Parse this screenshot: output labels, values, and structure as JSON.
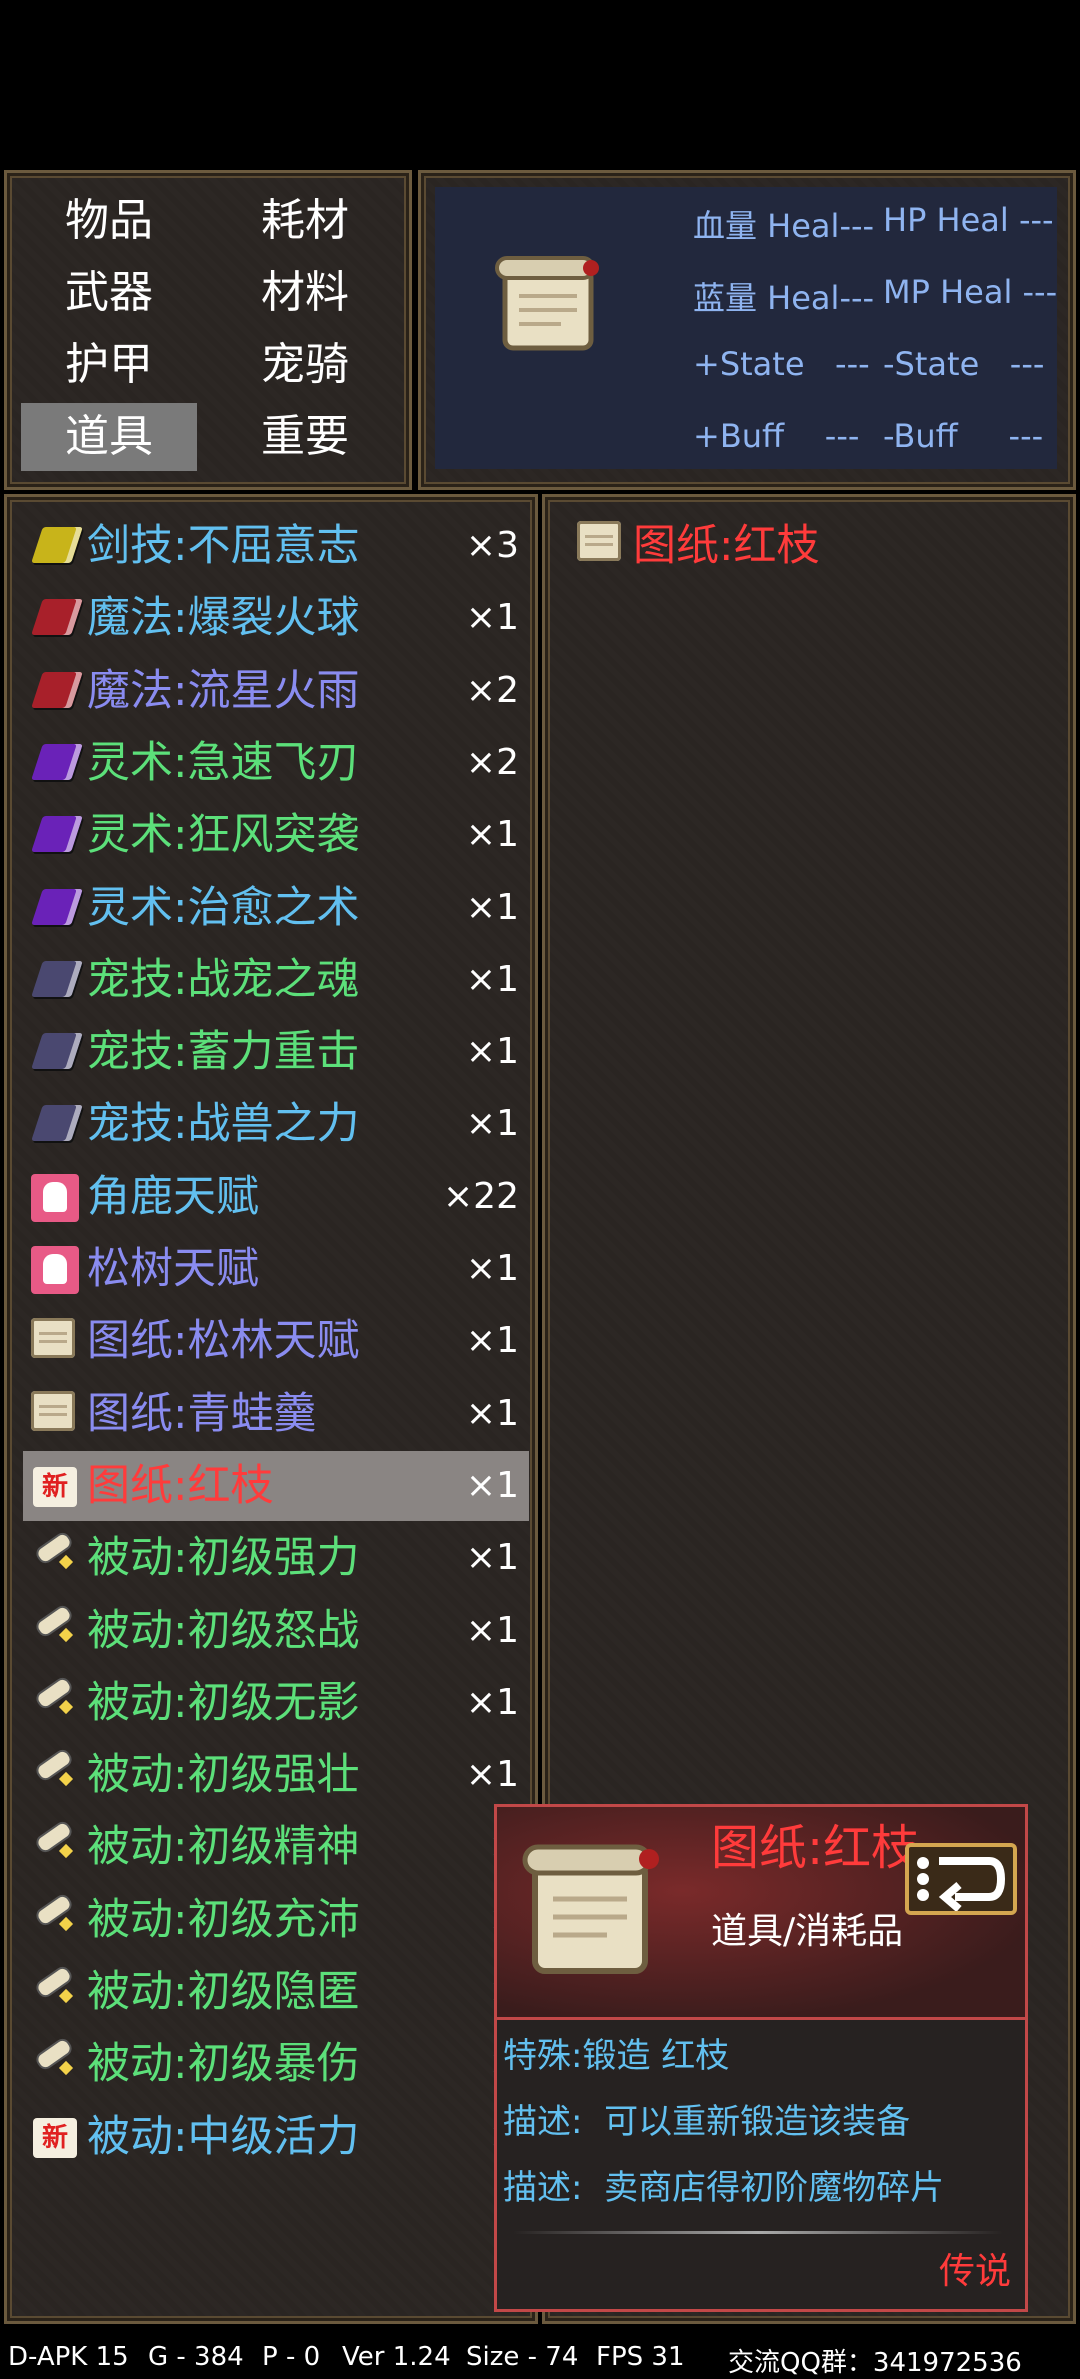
{
  "categories": [
    "物品",
    "耗材",
    "武器",
    "材料",
    "护甲",
    "宠骑",
    "道具",
    "重要"
  ],
  "selected_category": "道具",
  "stats": {
    "hp_heal_label": "血量 Heal",
    "hp_heal_value": "---",
    "hp_heal_en_label": "HP Heal",
    "hp_heal_en_value": "---",
    "mp_heal_label": "蓝量 Heal",
    "mp_heal_value": "---",
    "mp_heal_en_label": "MP Heal",
    "mp_heal_en_value": "---",
    "plus_state_label": "+State",
    "plus_state_value": "---",
    "minus_state_label": "-State",
    "minus_state_value": "---",
    "plus_buff_label": "+Buff",
    "plus_buff_value": "---",
    "minus_buff_label": "-Buff",
    "minus_buff_value": "---"
  },
  "items": [
    {
      "name": "剑技:不屈意志",
      "count": "×3",
      "color": "#62c0f0",
      "icon": "yellow-book-icon"
    },
    {
      "name": "魔法:爆裂火球",
      "count": "×1",
      "color": "#62c0f0",
      "icon": "red-book-icon"
    },
    {
      "name": "魔法:流星火雨",
      "count": "×2",
      "color": "#8a8cf0",
      "icon": "red-book-icon"
    },
    {
      "name": "灵术:急速飞刃",
      "count": "×2",
      "color": "#5ce07a",
      "icon": "purple-book-icon"
    },
    {
      "name": "灵术:狂风突袭",
      "count": "×1",
      "color": "#5ce07a",
      "icon": "purple-book-icon"
    },
    {
      "name": "灵术:治愈之术",
      "count": "×1",
      "color": "#62c0f0",
      "icon": "purple-book-icon"
    },
    {
      "name": "宠技:战宠之魂",
      "count": "×1",
      "color": "#5ce07a",
      "icon": "slate-book-icon"
    },
    {
      "name": "宠技:蓄力重击",
      "count": "×1",
      "color": "#5ce07a",
      "icon": "slate-book-icon"
    },
    {
      "name": "宠技:战兽之力",
      "count": "×1",
      "color": "#62c0f0",
      "icon": "slate-book-icon"
    },
    {
      "name": "角鹿天赋",
      "count": "×22",
      "color": "#62c0f0",
      "icon": "talent-icon"
    },
    {
      "name": "松树天赋",
      "count": "×1",
      "color": "#8a8cf0",
      "icon": "talent-icon"
    },
    {
      "name": "图纸:松林天赋",
      "count": "×1",
      "color": "#8a8cf0",
      "icon": "scroll-icon"
    },
    {
      "name": "图纸:青蛙羹",
      "count": "×1",
      "color": "#8a8cf0",
      "icon": "scroll-icon"
    },
    {
      "name": "图纸:红枝",
      "count": "×1",
      "color": "#ff3b3b",
      "icon": "new-badge-icon"
    },
    {
      "name": "被动:初级强力",
      "count": "×1",
      "color": "#5ce07a",
      "icon": "passive-scroll-icon"
    },
    {
      "name": "被动:初级怒战",
      "count": "×1",
      "color": "#5ce07a",
      "icon": "passive-scroll-icon"
    },
    {
      "name": "被动:初级无影",
      "count": "×1",
      "color": "#5ce07a",
      "icon": "passive-scroll-icon"
    },
    {
      "name": "被动:初级强壮",
      "count": "×1",
      "color": "#5ce07a",
      "icon": "passive-scroll-icon"
    },
    {
      "name": "被动:初级精神",
      "count": "×",
      "color": "#5ce07a",
      "icon": "passive-scroll-icon"
    },
    {
      "name": "被动:初级充沛",
      "count": "×",
      "color": "#5ce07a",
      "icon": "passive-scroll-icon"
    },
    {
      "name": "被动:初级隐匿",
      "count": "×",
      "color": "#5ce07a",
      "icon": "passive-scroll-icon"
    },
    {
      "name": "被动:初级暴伤",
      "count": "×",
      "color": "#5ce07a",
      "icon": "passive-scroll-icon"
    },
    {
      "name": "被动:中级活力",
      "count": "×",
      "color": "#62c0f0",
      "icon": "new-badge-icon"
    }
  ],
  "selected_item_index": 13,
  "new_badge_text": "新",
  "detail": {
    "name": "图纸:红枝",
    "color": "#ff3b3b"
  },
  "tooltip": {
    "name": "图纸:红枝",
    "type": "道具/消耗品",
    "special": "特殊:锻造 红枝",
    "desc1": "描述:  可以重新锻造该装备",
    "desc2": "描述:  卖商店得初阶魔物碎片",
    "rarity": "传说"
  },
  "status_bar": {
    "build": "D-APK 15",
    "gold": "G - 384",
    "points": "P - 0",
    "version": "Ver 1.24",
    "size": "Size - 74",
    "fps": "FPS 31",
    "qq": "交流QQ群：341972536"
  }
}
